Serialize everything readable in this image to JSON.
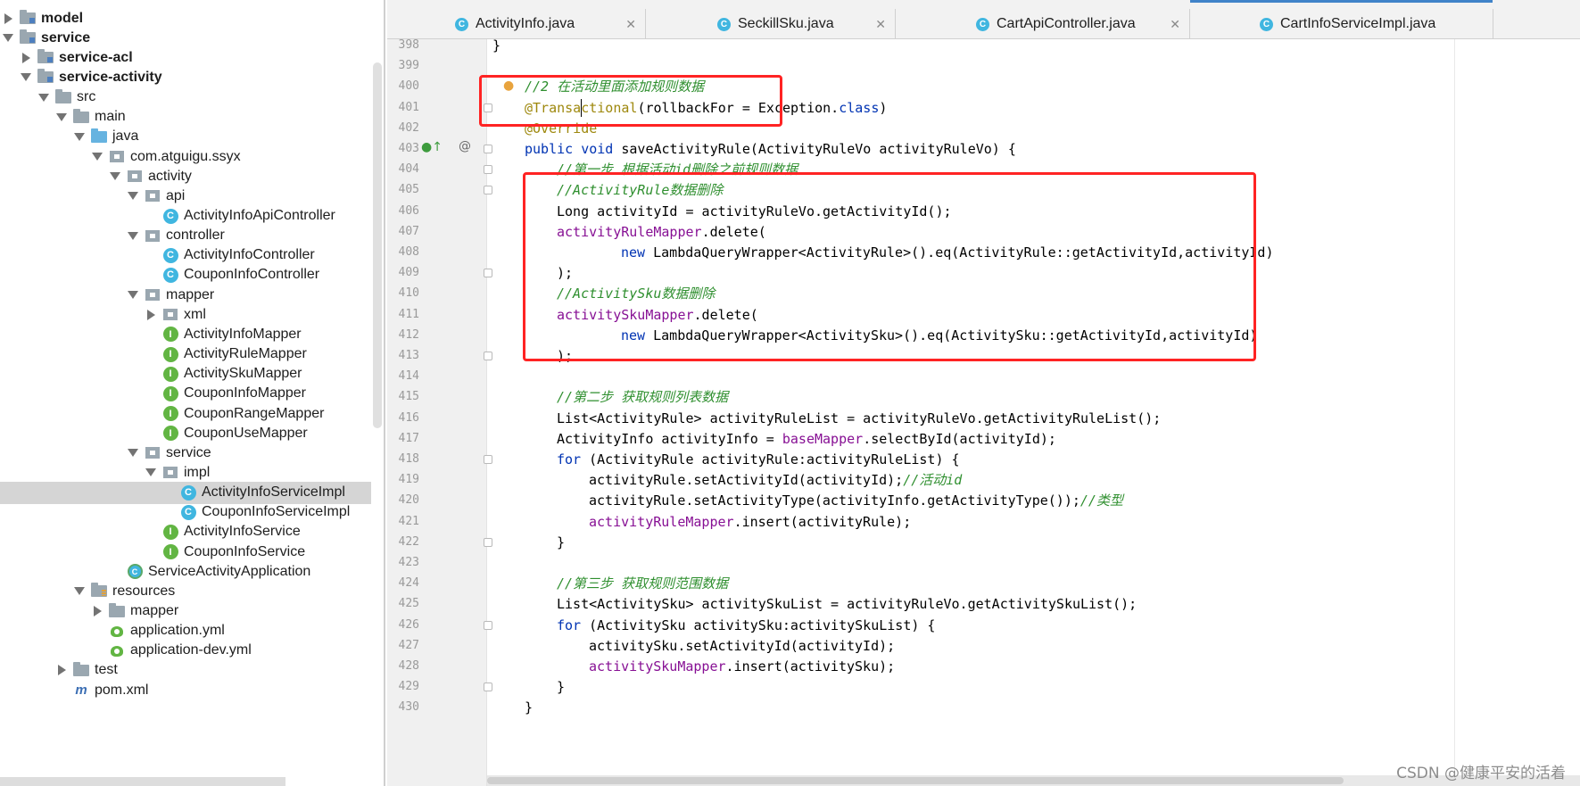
{
  "project_tree": [
    {
      "label": "model",
      "depth": 0,
      "state": "collapsed",
      "icon": "module-folder-icon",
      "bold": true
    },
    {
      "label": "service",
      "depth": 0,
      "state": "expanded",
      "icon": "module-folder-icon",
      "bold": true
    },
    {
      "label": "service-acl",
      "depth": 1,
      "state": "collapsed",
      "icon": "module-folder-icon",
      "bold": true
    },
    {
      "label": "service-activity",
      "depth": 1,
      "state": "expanded",
      "icon": "module-folder-icon",
      "bold": true
    },
    {
      "label": "src",
      "depth": 2,
      "state": "expanded",
      "icon": "folder-icon"
    },
    {
      "label": "main",
      "depth": 3,
      "state": "expanded",
      "icon": "folder-icon"
    },
    {
      "label": "java",
      "depth": 4,
      "state": "expanded",
      "icon": "source-folder-icon"
    },
    {
      "label": "com.atguigu.ssyx",
      "depth": 5,
      "state": "expanded",
      "icon": "package-icon"
    },
    {
      "label": "activity",
      "depth": 6,
      "state": "expanded",
      "icon": "package-icon"
    },
    {
      "label": "api",
      "depth": 7,
      "state": "expanded",
      "icon": "package-icon"
    },
    {
      "label": "ActivityInfoApiController",
      "depth": 8,
      "state": "none",
      "icon": "class-icon"
    },
    {
      "label": "controller",
      "depth": 7,
      "state": "expanded",
      "icon": "package-icon"
    },
    {
      "label": "ActivityInfoController",
      "depth": 8,
      "state": "none",
      "icon": "class-icon"
    },
    {
      "label": "CouponInfoController",
      "depth": 8,
      "state": "none",
      "icon": "class-icon"
    },
    {
      "label": "mapper",
      "depth": 7,
      "state": "expanded",
      "icon": "package-icon"
    },
    {
      "label": "xml",
      "depth": 8,
      "state": "collapsed",
      "icon": "package-icon"
    },
    {
      "label": "ActivityInfoMapper",
      "depth": 8,
      "state": "none",
      "icon": "interface-icon"
    },
    {
      "label": "ActivityRuleMapper",
      "depth": 8,
      "state": "none",
      "icon": "interface-icon"
    },
    {
      "label": "ActivitySkuMapper",
      "depth": 8,
      "state": "none",
      "icon": "interface-icon"
    },
    {
      "label": "CouponInfoMapper",
      "depth": 8,
      "state": "none",
      "icon": "interface-icon"
    },
    {
      "label": "CouponRangeMapper",
      "depth": 8,
      "state": "none",
      "icon": "interface-icon"
    },
    {
      "label": "CouponUseMapper",
      "depth": 8,
      "state": "none",
      "icon": "interface-icon"
    },
    {
      "label": "service",
      "depth": 7,
      "state": "expanded",
      "icon": "package-icon"
    },
    {
      "label": "impl",
      "depth": 8,
      "state": "expanded",
      "icon": "package-icon"
    },
    {
      "label": "ActivityInfoServiceImpl",
      "depth": 9,
      "state": "none",
      "icon": "class-icon",
      "selected": true
    },
    {
      "label": "CouponInfoServiceImpl",
      "depth": 9,
      "state": "none",
      "icon": "class-icon"
    },
    {
      "label": "ActivityInfoService",
      "depth": 8,
      "state": "none",
      "icon": "interface-icon"
    },
    {
      "label": "CouponInfoService",
      "depth": 8,
      "state": "none",
      "icon": "interface-icon"
    },
    {
      "label": "ServiceActivityApplication",
      "depth": 6,
      "state": "none",
      "icon": "app-class-icon"
    },
    {
      "label": "resources",
      "depth": 4,
      "state": "expanded",
      "icon": "resources-folder-icon"
    },
    {
      "label": "mapper",
      "depth": 5,
      "state": "collapsed",
      "icon": "folder-icon"
    },
    {
      "label": "application.yml",
      "depth": 5,
      "state": "none",
      "icon": "yml-icon"
    },
    {
      "label": "application-dev.yml",
      "depth": 5,
      "state": "none",
      "icon": "yml-icon"
    },
    {
      "label": "test",
      "depth": 3,
      "state": "collapsed",
      "icon": "folder-icon"
    },
    {
      "label": "pom.xml",
      "depth": 3,
      "state": "none",
      "icon": "maven-icon"
    }
  ],
  "tabs": [
    {
      "label": "ActivityInfo.java",
      "active": false,
      "closable": true
    },
    {
      "label": "SeckillSku.java",
      "active": false,
      "closable": true
    },
    {
      "label": "CartApiController.java",
      "active": false,
      "closable": true
    },
    {
      "label": "CartInfoServiceImpl.java",
      "active": true,
      "closable": false
    }
  ],
  "code_lines": [
    {
      "n": "398",
      "indent": 0,
      "parts": [
        {
          "t": "}",
          "c": ""
        }
      ]
    },
    {
      "n": "399",
      "indent": 0,
      "parts": []
    },
    {
      "n": "400",
      "indent": 1,
      "parts": [
        {
          "t": "//2 在活动里面添加规则数据",
          "c": "comment"
        }
      ]
    },
    {
      "n": "401",
      "indent": 1,
      "parts": [
        {
          "t": "@Transactional",
          "c": "anno"
        },
        {
          "t": "(rollbackFor = Exception.",
          "c": ""
        },
        {
          "t": "class",
          "c": "kw"
        },
        {
          "t": ")",
          "c": ""
        }
      ]
    },
    {
      "n": "402",
      "indent": 1,
      "parts": [
        {
          "t": "@Override",
          "c": "anno"
        }
      ]
    },
    {
      "n": "403",
      "indent": 1,
      "parts": [
        {
          "t": "public void ",
          "c": "kw"
        },
        {
          "t": "saveActivityRule(ActivityRuleVo activityRuleVo) {",
          "c": ""
        }
      ]
    },
    {
      "n": "404",
      "indent": 2,
      "parts": [
        {
          "t": "//第一步 根据活动id删除之前规则数据",
          "c": "comment"
        }
      ]
    },
    {
      "n": "405",
      "indent": 2,
      "parts": [
        {
          "t": "//ActivityRule数据删除",
          "c": "comment"
        }
      ]
    },
    {
      "n": "406",
      "indent": 2,
      "parts": [
        {
          "t": "Long activityId = activityRuleVo.getActivityId();",
          "c": ""
        }
      ]
    },
    {
      "n": "407",
      "indent": 2,
      "parts": [
        {
          "t": "activityRuleMapper",
          "c": "field"
        },
        {
          "t": ".delete(",
          "c": ""
        }
      ]
    },
    {
      "n": "408",
      "indent": 4,
      "parts": [
        {
          "t": "new ",
          "c": "kw"
        },
        {
          "t": "LambdaQueryWrapper<ActivityRule>().eq(ActivityRule::getActivityId,activityId)",
          "c": ""
        }
      ]
    },
    {
      "n": "409",
      "indent": 2,
      "parts": [
        {
          "t": ");",
          "c": ""
        }
      ]
    },
    {
      "n": "410",
      "indent": 2,
      "parts": [
        {
          "t": "//ActivitySku数据删除",
          "c": "comment"
        }
      ]
    },
    {
      "n": "411",
      "indent": 2,
      "parts": [
        {
          "t": "activitySkuMapper",
          "c": "field"
        },
        {
          "t": ".delete(",
          "c": ""
        }
      ]
    },
    {
      "n": "412",
      "indent": 4,
      "parts": [
        {
          "t": "new ",
          "c": "kw"
        },
        {
          "t": "LambdaQueryWrapper<ActivitySku>().eq(ActivitySku::getActivityId,activityId)",
          "c": ""
        }
      ]
    },
    {
      "n": "413",
      "indent": 2,
      "parts": [
        {
          "t": ");",
          "c": ""
        }
      ]
    },
    {
      "n": "414",
      "indent": 0,
      "parts": []
    },
    {
      "n": "415",
      "indent": 2,
      "parts": [
        {
          "t": "//第二步 获取规则列表数据",
          "c": "comment"
        }
      ]
    },
    {
      "n": "416",
      "indent": 2,
      "parts": [
        {
          "t": "List<ActivityRule> activityRuleList = activityRuleVo.getActivityRuleList();",
          "c": ""
        }
      ]
    },
    {
      "n": "417",
      "indent": 2,
      "parts": [
        {
          "t": "ActivityInfo activityInfo = ",
          "c": ""
        },
        {
          "t": "baseMapper",
          "c": "field"
        },
        {
          "t": ".selectById(activityId);",
          "c": ""
        }
      ]
    },
    {
      "n": "418",
      "indent": 2,
      "parts": [
        {
          "t": "for ",
          "c": "kw"
        },
        {
          "t": "(ActivityRule activityRule:activityRuleList) {",
          "c": ""
        }
      ]
    },
    {
      "n": "419",
      "indent": 3,
      "parts": [
        {
          "t": "activityRule.setActivityId(activityId);",
          "c": ""
        },
        {
          "t": "//活动id",
          "c": "comment"
        }
      ]
    },
    {
      "n": "420",
      "indent": 3,
      "parts": [
        {
          "t": "activityRule.setActivityType(activityInfo.getActivityType());",
          "c": ""
        },
        {
          "t": "//类型",
          "c": "comment"
        }
      ]
    },
    {
      "n": "421",
      "indent": 3,
      "parts": [
        {
          "t": "activityRuleMapper",
          "c": "field"
        },
        {
          "t": ".insert(activityRule);",
          "c": ""
        }
      ]
    },
    {
      "n": "422",
      "indent": 2,
      "parts": [
        {
          "t": "}",
          "c": ""
        }
      ]
    },
    {
      "n": "423",
      "indent": 0,
      "parts": []
    },
    {
      "n": "424",
      "indent": 2,
      "parts": [
        {
          "t": "//第三步 获取规则范围数据",
          "c": "comment"
        }
      ]
    },
    {
      "n": "425",
      "indent": 2,
      "parts": [
        {
          "t": "List<ActivitySku> activitySkuList = activityRuleVo.getActivitySkuList();",
          "c": ""
        }
      ]
    },
    {
      "n": "426",
      "indent": 2,
      "parts": [
        {
          "t": "for ",
          "c": "kw"
        },
        {
          "t": "(ActivitySku activitySku:activitySkuList) {",
          "c": ""
        }
      ]
    },
    {
      "n": "427",
      "indent": 3,
      "parts": [
        {
          "t": "activitySku.setActivityId(activityId);",
          "c": ""
        }
      ]
    },
    {
      "n": "428",
      "indent": 3,
      "parts": [
        {
          "t": "activitySkuMapper",
          "c": "field"
        },
        {
          "t": ".insert(activitySku);",
          "c": ""
        }
      ]
    },
    {
      "n": "429",
      "indent": 2,
      "parts": [
        {
          "t": "}",
          "c": ""
        }
      ]
    },
    {
      "n": "430",
      "indent": 1,
      "parts": [
        {
          "t": "}",
          "c": ""
        }
      ]
    }
  ],
  "watermark": "CSDN @健康平安的活着",
  "colors": {
    "comment": "#2f8f2f",
    "keyword": "#0033b3",
    "annotation": "#9e880d",
    "field": "#871094",
    "highlight_box": "#ff2323",
    "selection": "#d5d5d5"
  }
}
